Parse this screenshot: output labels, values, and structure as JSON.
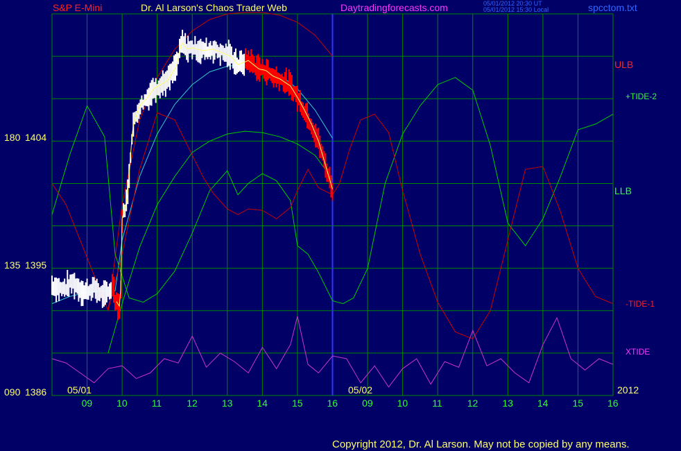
{
  "header": {
    "symbol": "S&P E-Mini",
    "title": "Dr. Al Larson's Chaos Trader Web",
    "site": "Daytradingforecasts.com",
    "stamp_ut": "05/01/2012 20:30 UT",
    "stamp_local": "05/01/2012 15:30 Local",
    "file": "spcctom.txt"
  },
  "footer": {
    "copyright": "Copyright 2012, Dr. Al Larson. May not be copied by any means."
  },
  "colors": {
    "background": "#000066",
    "grid": "#008800",
    "price_up": "#ffffff",
    "price_down": "#ff0000",
    "ulb": "#cc0000",
    "llb": "#00cc00",
    "tide_plus": "#00cc00",
    "tide_minus": "#cc0000",
    "xtide": "#cc33cc",
    "cyan_avg": "#33cccc",
    "yellow_avg": "#ffff66",
    "divider": "#3333ff"
  },
  "chart_data": {
    "type": "line",
    "title": "S&P E-Mini",
    "y_price_labels": [
      "1404",
      "1395",
      "1386"
    ],
    "y_angle_labels": [
      "180",
      "135",
      "090"
    ],
    "ylim": [
      1386,
      1413
    ],
    "x_hour_labels": [
      "09",
      "10",
      "11",
      "12",
      "13",
      "14",
      "15",
      "16",
      "09",
      "10",
      "11",
      "12",
      "13",
      "14",
      "15",
      "16"
    ],
    "date_labels": [
      "05/01",
      "05/02",
      "2012"
    ],
    "right_labels": [
      "ULB",
      "+TIDE-2",
      "LLB",
      "-TIDE-1",
      "XTIDE"
    ],
    "xlim": [
      8.0,
      24.0
    ],
    "series": [
      {
        "name": "Price",
        "x": [
          8.0,
          8.3,
          8.6,
          8.9,
          9.2,
          9.5,
          9.75,
          9.8,
          9.95,
          10.0,
          10.15,
          10.3,
          10.5,
          10.7,
          10.9,
          11.1,
          11.3,
          11.55,
          11.7,
          11.85,
          12.0,
          12.3,
          12.6,
          12.9,
          13.1,
          13.3,
          13.6,
          13.9,
          14.1,
          14.3,
          14.5,
          14.8,
          15.0,
          15.2,
          15.4,
          15.6,
          15.8,
          16.0
        ],
        "y": [
          1393.8,
          1393.5,
          1394.0,
          1393.3,
          1393.6,
          1393.0,
          1393.8,
          1392.8,
          1392.2,
          1398.5,
          1400.0,
          1405.0,
          1406.5,
          1407.0,
          1407.7,
          1408.0,
          1408.3,
          1409.3,
          1411.0,
          1410.5,
          1410.6,
          1410.4,
          1410.5,
          1410.2,
          1410.0,
          1409.4,
          1409.7,
          1409.1,
          1409.0,
          1408.6,
          1408.4,
          1407.9,
          1407.1,
          1406.2,
          1405.2,
          1404.0,
          1402.3,
          1400.6
        ]
      },
      {
        "name": "cyan_avg",
        "x": [
          8.0,
          8.5,
          9.0,
          9.5,
          9.8,
          10.0,
          10.5,
          11.0,
          11.5,
          12.0,
          12.5,
          13.0,
          13.5,
          14.0,
          14.5,
          15.0,
          15.5,
          16.0
        ],
        "y": [
          1392.5,
          1393.0,
          1393.3,
          1393.4,
          1393.4,
          1397.0,
          1401.5,
          1404.5,
          1406.6,
          1408.0,
          1408.9,
          1409.3,
          1409.4,
          1409.2,
          1408.7,
          1407.7,
          1406.2,
          1404.2
        ]
      },
      {
        "name": "ULB",
        "x": [
          9.6,
          10.0,
          10.5,
          11.0,
          11.5,
          12.0,
          12.5,
          13.0,
          13.5,
          14.0,
          14.5,
          15.0,
          15.5,
          16.0
        ],
        "y": [
          1392.0,
          1399.5,
          1405.5,
          1408.5,
          1410.5,
          1411.8,
          1412.6,
          1413.0,
          1413.1,
          1413.1,
          1412.9,
          1412.4,
          1411.5,
          1410.0
        ]
      },
      {
        "name": "LLB",
        "x": [
          9.6,
          10.0,
          10.5,
          11.0,
          11.5,
          12.0,
          12.5,
          13.0,
          13.5,
          14.0,
          14.5,
          15.0,
          15.5,
          16.0
        ],
        "y": [
          1389.0,
          1392.5,
          1396.5,
          1399.5,
          1401.5,
          1403.2,
          1404.0,
          1404.5,
          1404.7,
          1404.6,
          1404.3,
          1403.8,
          1403.0,
          1401.3
        ]
      },
      {
        "name": "+TIDE-2",
        "x": [
          8.0,
          8.5,
          9.0,
          9.5,
          9.8,
          10.2,
          10.6,
          11.0,
          11.5,
          12.0,
          12.5,
          13.0,
          13.3,
          13.6,
          14.0,
          14.4,
          14.8,
          15.0,
          15.3,
          15.6,
          16.0,
          16.3,
          16.6,
          17.0,
          17.5,
          18.0,
          18.5,
          19.0,
          19.5,
          20.0,
          20.5,
          21.0,
          21.5,
          22.0,
          22.5,
          23.0,
          23.5,
          24.0
        ],
        "y": [
          1398.8,
          1403.0,
          1406.5,
          1404.3,
          1396.0,
          1392.9,
          1392.6,
          1393.2,
          1394.8,
          1397.5,
          1400.5,
          1401.9,
          1400.2,
          1401.0,
          1401.7,
          1401.2,
          1399.8,
          1396.6,
          1396.0,
          1394.7,
          1392.7,
          1392.5,
          1392.9,
          1395.0,
          1401.0,
          1404.5,
          1406.5,
          1408.0,
          1408.5,
          1407.6,
          1403.7,
          1398.2,
          1396.6,
          1398.5,
          1401.5,
          1404.8,
          1405.2,
          1405.9
        ]
      },
      {
        "name": "-TIDE-1",
        "x": [
          8.0,
          8.4,
          8.8,
          9.2,
          9.6,
          10.0,
          10.5,
          11.0,
          11.5,
          12.0,
          12.3,
          12.6,
          13.0,
          13.3,
          13.6,
          14.0,
          14.4,
          14.8,
          15.0,
          15.3,
          15.6,
          16.0,
          16.2,
          16.5,
          16.8,
          17.2,
          17.6,
          18.0,
          18.5,
          19.0,
          19.5,
          20.0,
          20.5,
          21.0,
          21.5,
          22.0,
          22.5,
          23.0,
          23.5,
          24.0
        ],
        "y": [
          1401.0,
          1399.5,
          1397.0,
          1394.5,
          1392.0,
          1396.0,
          1402.0,
          1406.0,
          1405.5,
          1403.0,
          1401.5,
          1400.3,
          1399.2,
          1398.8,
          1399.2,
          1399.1,
          1398.5,
          1399.3,
          1400.5,
          1402.0,
          1400.7,
          1400.2,
          1401.0,
          1403.5,
          1405.5,
          1405.9,
          1404.6,
          1400.5,
          1396.0,
          1392.6,
          1390.5,
          1390.0,
          1392.0,
          1397.0,
          1402.0,
          1402.2,
          1399.0,
          1395.0,
          1393.0,
          1392.5
        ]
      },
      {
        "name": "XTIDE",
        "x": [
          8.0,
          8.4,
          8.8,
          9.2,
          9.6,
          10.0,
          10.4,
          10.8,
          11.2,
          11.6,
          12.0,
          12.4,
          12.8,
          13.2,
          13.6,
          14.0,
          14.4,
          14.8,
          15.0,
          15.3,
          15.6,
          16.0,
          16.4,
          16.8,
          17.2,
          17.6,
          18.0,
          18.4,
          18.8,
          19.2,
          19.6,
          20.0,
          20.4,
          20.8,
          21.2,
          21.6,
          22.0,
          22.4,
          22.8,
          23.2,
          23.6,
          24.0
        ],
        "y": [
          1388.6,
          1388.3,
          1387.6,
          1386.9,
          1387.9,
          1388.1,
          1387.2,
          1387.6,
          1388.6,
          1388.3,
          1390.2,
          1388.0,
          1389.0,
          1388.4,
          1387.6,
          1389.4,
          1387.9,
          1389.6,
          1391.6,
          1388.2,
          1387.6,
          1388.8,
          1388.6,
          1386.9,
          1388.1,
          1386.6,
          1387.9,
          1388.6,
          1386.8,
          1388.4,
          1388.0,
          1390.6,
          1388.1,
          1388.6,
          1387.6,
          1386.9,
          1389.6,
          1391.5,
          1388.6,
          1387.8,
          1388.6,
          1388.2
        ]
      }
    ]
  }
}
